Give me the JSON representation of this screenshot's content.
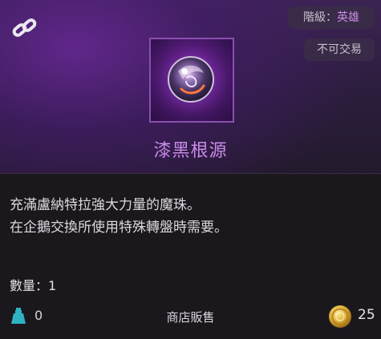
{
  "tooltip": {
    "grade_label": "階級：",
    "grade_value": "英雄",
    "trade_status": "不可交易",
    "item_name": "漆黑根源",
    "description": [
      "充滿盧納特拉強大力量的魔珠。",
      "在企鵝交換所使用特殊轉盤時需要。"
    ],
    "quantity_label": "數量：",
    "quantity_value": "1",
    "bag_count": "0",
    "shop_sell_label": "商店販售",
    "price": "25",
    "colors": {
      "grade_accent": "#c98ee6",
      "name_accent": "#c88be8",
      "bag_icon": "#2fb3c4",
      "coin": "#e0b33a"
    },
    "icons": {
      "link": "chain-link-icon",
      "item": "dark-orb-icon",
      "bag": "bag-icon",
      "currency": "gold-coin-icon"
    }
  }
}
